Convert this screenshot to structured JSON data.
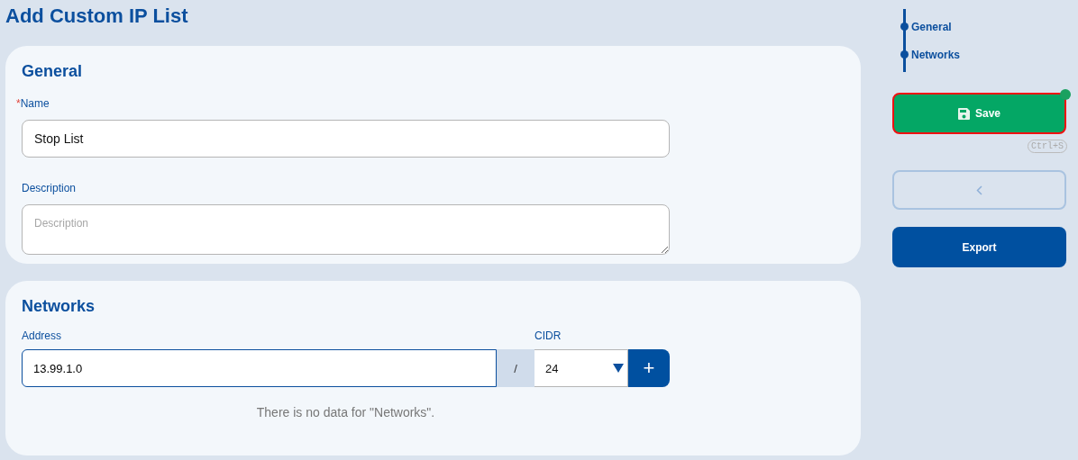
{
  "page": {
    "title": "Add Custom IP List"
  },
  "general": {
    "title": "General",
    "fields": [
      {
        "kind": "text",
        "required_mark": "*",
        "label": "Name",
        "value": "Stop List"
      },
      {
        "kind": "textarea",
        "label": "Description",
        "placeholder": "Description"
      }
    ]
  },
  "networks": {
    "title": "Networks",
    "address": {
      "label": "Address",
      "value": "13.99.1.0"
    },
    "separator": "/",
    "cidr": {
      "label": "CIDR",
      "value": "24"
    },
    "add_button": "+",
    "empty_text": "There is no data for \"Networks\"."
  },
  "nav": [
    {
      "label": "General"
    },
    {
      "label": "Networks"
    }
  ],
  "actions": {
    "save": {
      "label": "Save",
      "shortcut": "Ctrl+S",
      "focused": true
    },
    "export": {
      "label": "Export"
    }
  }
}
